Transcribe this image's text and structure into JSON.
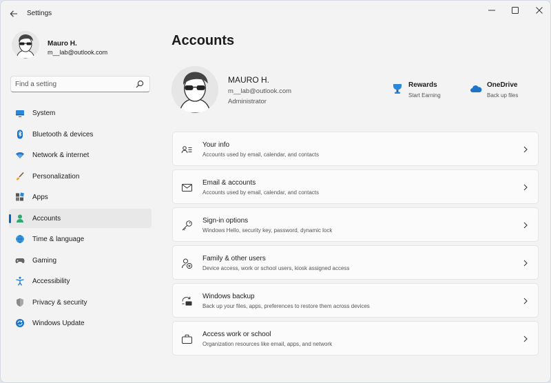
{
  "app": {
    "title": "Settings"
  },
  "user": {
    "name": "Mauro H.",
    "email": "m__lab@outlook.com"
  },
  "search": {
    "placeholder": "Find a setting"
  },
  "nav": {
    "selected": "Accounts",
    "items": [
      {
        "label": "System",
        "icon": "monitor-icon"
      },
      {
        "label": "Bluetooth & devices",
        "icon": "bluetooth-icon"
      },
      {
        "label": "Network & internet",
        "icon": "wifi-icon"
      },
      {
        "label": "Personalization",
        "icon": "brush-icon"
      },
      {
        "label": "Apps",
        "icon": "apps-icon"
      },
      {
        "label": "Accounts",
        "icon": "person-icon"
      },
      {
        "label": "Time & language",
        "icon": "globe-clock-icon"
      },
      {
        "label": "Gaming",
        "icon": "gamepad-icon"
      },
      {
        "label": "Accessibility",
        "icon": "accessibility-icon"
      },
      {
        "label": "Privacy & security",
        "icon": "shield-icon"
      },
      {
        "label": "Windows Update",
        "icon": "update-icon"
      }
    ]
  },
  "main": {
    "title": "Accounts",
    "profile": {
      "name": "MAURO H.",
      "email": "m__lab@outlook.com",
      "role": "Administrator"
    },
    "services": [
      {
        "title": "Rewards",
        "subtitle": "Start Earning",
        "icon": "trophy-icon"
      },
      {
        "title": "OneDrive",
        "subtitle": "Back up files",
        "icon": "cloud-icon"
      }
    ],
    "cards": [
      {
        "title": "Your info",
        "subtitle": "Accounts used by email, calendar, and contacts",
        "icon": "person-card-icon"
      },
      {
        "title": "Email & accounts",
        "subtitle": "Accounts used by email, calendar, and contacts",
        "icon": "mail-icon"
      },
      {
        "title": "Sign-in options",
        "subtitle": "Windows Hello, security key, password, dynamic lock",
        "icon": "key-icon"
      },
      {
        "title": "Family & other users",
        "subtitle": "Device access, work or school users, kiosk assigned access",
        "icon": "person-add-icon"
      },
      {
        "title": "Windows backup",
        "subtitle": "Back up your files, apps, preferences to restore them across devices",
        "icon": "backup-icon"
      },
      {
        "title": "Access work or school",
        "subtitle": "Organization resources like email, apps, and network",
        "icon": "briefcase-icon"
      }
    ]
  },
  "colors": {
    "accent": "#0067c0",
    "background": "#f3f3f3",
    "card": "#fbfbfb"
  }
}
